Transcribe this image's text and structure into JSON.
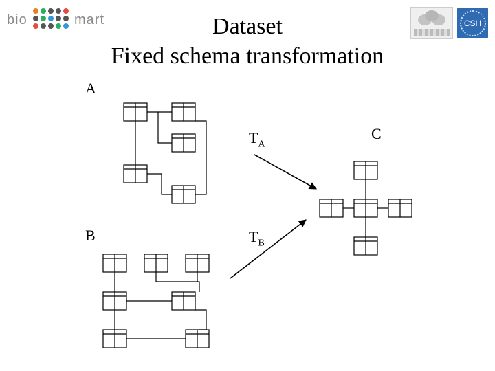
{
  "title_line1": "Dataset",
  "title_line2": "Fixed schema transformation",
  "labels": {
    "A": "A",
    "B": "B",
    "C": "C"
  },
  "transforms": {
    "TA_base": "T",
    "TA_sub": "A",
    "TB_base": "T",
    "TB_sub": "B"
  },
  "logo": {
    "left": "bio",
    "right": "mart"
  },
  "badges": {
    "csh": "CSH"
  },
  "dot_colors": [
    "#e67e22",
    "#27ae60",
    "#555555",
    "#555555",
    "#e74c3c",
    "#555555",
    "#27ae60",
    "#3498db",
    "#555555",
    "#555555",
    "#e74c3c",
    "#555555",
    "#555555",
    "#27ae60",
    "#3498db"
  ]
}
